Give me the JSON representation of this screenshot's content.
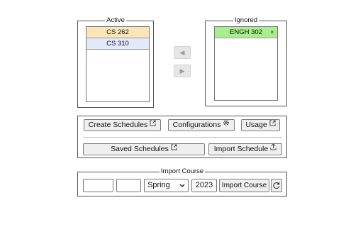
{
  "active": {
    "legend": "Active",
    "courses": [
      {
        "label": "CS 262",
        "color": "#fae5b9"
      },
      {
        "label": "CS 310",
        "color": "#e4e8fb"
      }
    ]
  },
  "ignored": {
    "legend": "Ignored",
    "courses": [
      {
        "label": "ENGH 302",
        "color": "#a8ee8d",
        "remove": "×"
      }
    ]
  },
  "transfer": {
    "left_arrow": "◀",
    "right_arrow": "▶"
  },
  "actions": {
    "create_schedules": "Create Schedules",
    "configurations": "Configurations",
    "usage": "Usage",
    "saved_schedules": "Saved Schedules",
    "import_schedule": "Import Schedule"
  },
  "import_course": {
    "legend": "Import Course",
    "field1_value": "",
    "field2_value": "",
    "term_selected": "Spring",
    "year": "2023",
    "import_button": "Import Course"
  }
}
